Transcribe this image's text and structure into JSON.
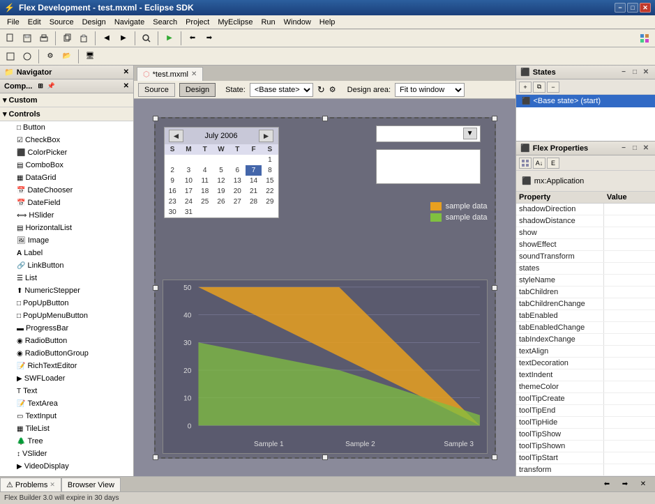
{
  "titleBar": {
    "title": "Flex Development - test.mxml - Eclipse SDK",
    "minBtn": "−",
    "maxBtn": "□",
    "closeBtn": "✕"
  },
  "menuBar": {
    "items": [
      "File",
      "Edit",
      "Source",
      "Design",
      "Navigate",
      "Search",
      "Project",
      "MyEclipse",
      "Run",
      "Window",
      "Help"
    ]
  },
  "toolbar1": {
    "buttons": [
      "⬛",
      "💾",
      "🖨",
      "|",
      "📋",
      "📋",
      "|",
      "⏪",
      "⏩",
      "|",
      "🔍",
      "|",
      "▶",
      "|",
      "◀",
      "▶"
    ]
  },
  "toolbar2": {
    "buttons": [
      "📋",
      "📋",
      "|",
      "🔧",
      "📂",
      "|",
      "🖥",
      "|",
      "📝"
    ]
  },
  "navigatorPanel": {
    "title": "Navigator",
    "closeBtn": "✕"
  },
  "componentPanel": {
    "title": "Comp...",
    "closeBtn": "✕",
    "pinBtn": "📌",
    "sections": [
      {
        "label": "Custom",
        "expanded": true
      },
      {
        "label": "Controls",
        "expanded": true,
        "items": [
          {
            "label": "Button",
            "icon": "□"
          },
          {
            "label": "CheckBox",
            "icon": "☑"
          },
          {
            "label": "ColorPicker",
            "icon": "🎨"
          },
          {
            "label": "ComboBox",
            "icon": "▤"
          },
          {
            "label": "DataGrid",
            "icon": "▦"
          },
          {
            "label": "DateChooser",
            "icon": "📅"
          },
          {
            "label": "DateField",
            "icon": "📅"
          },
          {
            "label": "HSlider",
            "icon": "⟺"
          },
          {
            "label": "HorizontalList",
            "icon": "▤"
          },
          {
            "label": "Image",
            "icon": "🖼"
          },
          {
            "label": "Label",
            "icon": "A"
          },
          {
            "label": "LinkButton",
            "icon": "🔗"
          },
          {
            "label": "List",
            "icon": "☰"
          },
          {
            "label": "NumericStepper",
            "icon": "⬆"
          },
          {
            "label": "PopUpButton",
            "icon": "□"
          },
          {
            "label": "PopUpMenuButton",
            "icon": "□"
          },
          {
            "label": "ProgressBar",
            "icon": "▬"
          },
          {
            "label": "RadioButton",
            "icon": "◉"
          },
          {
            "label": "RadioButtonGroup",
            "icon": "◉"
          },
          {
            "label": "RichTextEditor",
            "icon": "📝"
          },
          {
            "label": "SWFLoader",
            "icon": "▶"
          },
          {
            "label": "Text",
            "icon": "T"
          },
          {
            "label": "TextArea",
            "icon": "📝"
          },
          {
            "label": "TextInput",
            "icon": "▭"
          },
          {
            "label": "TileList",
            "icon": "▦"
          },
          {
            "label": "Tree",
            "icon": "🌲"
          },
          {
            "label": "VSlider",
            "icon": "↕"
          },
          {
            "label": "VideoDisplay",
            "icon": "▶"
          }
        ]
      }
    ]
  },
  "editorTab": {
    "label": "*test.mxml",
    "closeBtn": "✕"
  },
  "editorToolbar": {
    "sourceBtn": "Source",
    "designBtn": "Design",
    "stateLabel": "State:",
    "stateValue": "<Base state>",
    "designAreaLabel": "Design area:",
    "fitToWindow": "Fit to window",
    "refreshBtn": "↻",
    "settingsBtn": "⚙"
  },
  "calendar": {
    "prevBtn": "◄",
    "nextBtn": "►",
    "month": "July",
    "year": "2006",
    "dayHeaders": [
      "S",
      "M",
      "T",
      "W",
      "T",
      "F",
      "S"
    ],
    "weeks": [
      [
        "",
        "",
        "",
        "",
        "",
        "",
        "1"
      ],
      [
        "2",
        "3",
        "4",
        "5",
        "6",
        "7",
        "8"
      ],
      [
        "9",
        "10",
        "11",
        "12",
        "13",
        "14",
        "15"
      ],
      [
        "16",
        "17",
        "18",
        "19",
        "20",
        "21",
        "22"
      ],
      [
        "23",
        "24",
        "25",
        "26",
        "27",
        "28",
        "29"
      ],
      [
        "30",
        "31",
        "",
        "",
        "",
        "",
        ""
      ]
    ],
    "todayCell": "7"
  },
  "legend": {
    "items": [
      {
        "label": "sample data",
        "color": "#e8a020"
      },
      {
        "label": "sample data",
        "color": "#80c040"
      }
    ]
  },
  "chart": {
    "yLabels": [
      "50",
      "40",
      "30",
      "20",
      "10",
      "0"
    ],
    "xLabels": [
      "Sample 1",
      "Sample 2",
      "Sample 3"
    ],
    "orangeData": [
      50,
      50,
      0
    ],
    "greenData": [
      30,
      15,
      5
    ]
  },
  "statesPanel": {
    "title": "States",
    "closeBtn": "✕",
    "items": [
      {
        "label": "<Base state> (start)",
        "icon": "⬛"
      }
    ]
  },
  "flexPropsPanel": {
    "title": "Flex Properties",
    "closeBtn": "✕",
    "treeLabel": "mx:Application",
    "columnHeaders": [
      "Property",
      "Value"
    ],
    "properties": [
      {
        "name": "shadowDirection",
        "value": ""
      },
      {
        "name": "shadowDistance",
        "value": ""
      },
      {
        "name": "show",
        "value": ""
      },
      {
        "name": "showEffect",
        "value": ""
      },
      {
        "name": "soundTransform",
        "value": ""
      },
      {
        "name": "states",
        "value": ""
      },
      {
        "name": "styleName",
        "value": ""
      },
      {
        "name": "tabChildren",
        "value": ""
      },
      {
        "name": "tabChildrenChange",
        "value": ""
      },
      {
        "name": "tabEnabled",
        "value": ""
      },
      {
        "name": "tabEnabledChange",
        "value": ""
      },
      {
        "name": "tabIndexChange",
        "value": ""
      },
      {
        "name": "textAlign",
        "value": ""
      },
      {
        "name": "textDecoration",
        "value": ""
      },
      {
        "name": "textIndent",
        "value": ""
      },
      {
        "name": "themeColor",
        "value": ""
      },
      {
        "name": "toolTipCreate",
        "value": ""
      },
      {
        "name": "toolTipEnd",
        "value": ""
      },
      {
        "name": "toolTipHide",
        "value": ""
      },
      {
        "name": "toolTipShow",
        "value": ""
      },
      {
        "name": "toolTipShown",
        "value": ""
      },
      {
        "name": "toolTipStart",
        "value": ""
      },
      {
        "name": "transform",
        "value": ""
      }
    ]
  },
  "bottomTabs": {
    "tabs": [
      "Problems",
      "Browser View"
    ]
  },
  "statusBar": {
    "text": "Flex Builder 3.0 will expire in 30 days"
  }
}
